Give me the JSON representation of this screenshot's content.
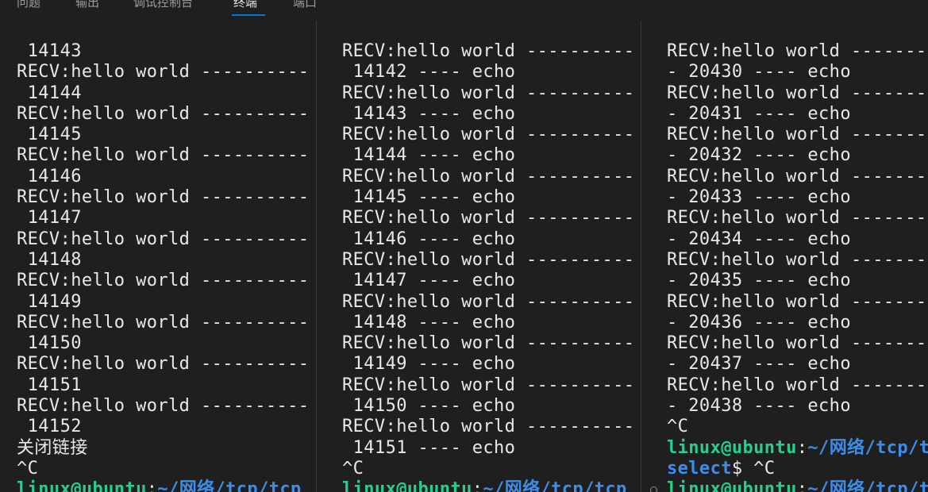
{
  "panel": {
    "tabs": [
      {
        "label": "问题"
      },
      {
        "label": "输出"
      },
      {
        "label": "调试控制台"
      },
      {
        "label": "终端",
        "active": true
      },
      {
        "label": "端口"
      }
    ]
  },
  "terminals": [
    {
      "lines": [
        " 14143",
        "RECV:hello world ----------",
        " 14144",
        "RECV:hello world ----------",
        " 14145",
        "RECV:hello world ----------",
        " 14146",
        "RECV:hello world ----------",
        " 14147",
        "RECV:hello world ----------",
        " 14148",
        "RECV:hello world ----------",
        " 14149",
        "RECV:hello world ----------",
        " 14150",
        "RECV:hello world ----------",
        " 14151",
        "RECV:hello world ----------",
        " 14152",
        "关闭链接",
        "^C"
      ],
      "prompt": {
        "user": "linux@ubuntu",
        "sep": ":",
        "path": "~/网络/tcp/tcp"
      }
    },
    {
      "lines": [
        "RECV:hello world ----------",
        " 14142 ---- echo",
        "RECV:hello world ----------",
        " 14143 ---- echo",
        "RECV:hello world ----------",
        " 14144 ---- echo",
        "RECV:hello world ----------",
        " 14145 ---- echo",
        "RECV:hello world ----------",
        " 14146 ---- echo",
        "RECV:hello world ----------",
        " 14147 ---- echo",
        "RECV:hello world ----------",
        " 14148 ---- echo",
        "RECV:hello world ----------",
        " 14149 ---- echo",
        "RECV:hello world ----------",
        " 14150 ---- echo",
        "RECV:hello world ----------",
        " 14151 ---- echo",
        "^C"
      ],
      "prompt": {
        "user": "linux@ubuntu",
        "sep": ":",
        "path": "~/网络/tcp/tcp"
      }
    },
    {
      "lines": [
        "RECV:hello world --------",
        "- 20430 ---- echo",
        "RECV:hello world --------",
        "- 20431 ---- echo",
        "RECV:hello world --------",
        "- 20432 ---- echo",
        "RECV:hello world --------",
        "- 20433 ---- echo",
        "RECV:hello world --------",
        "- 20434 ---- echo",
        "RECV:hello world --------",
        "- 20435 ---- echo",
        "RECV:hello world --------",
        "- 20436 ---- echo",
        "RECV:hello world --------",
        "- 20437 ---- echo",
        "RECV:hello world --------",
        "- 20438 ---- echo",
        "^C"
      ],
      "prompt1": {
        "user": "linux@ubuntu",
        "sep": ":",
        "path": "~/网络/tcp/t"
      },
      "prompt1_cont": {
        "path": "select",
        "rest": "$ ^C"
      },
      "prompt2": {
        "user": "linux@ubuntu",
        "sep": ":",
        "path": "~/网络/tcp/t"
      }
    }
  ]
}
